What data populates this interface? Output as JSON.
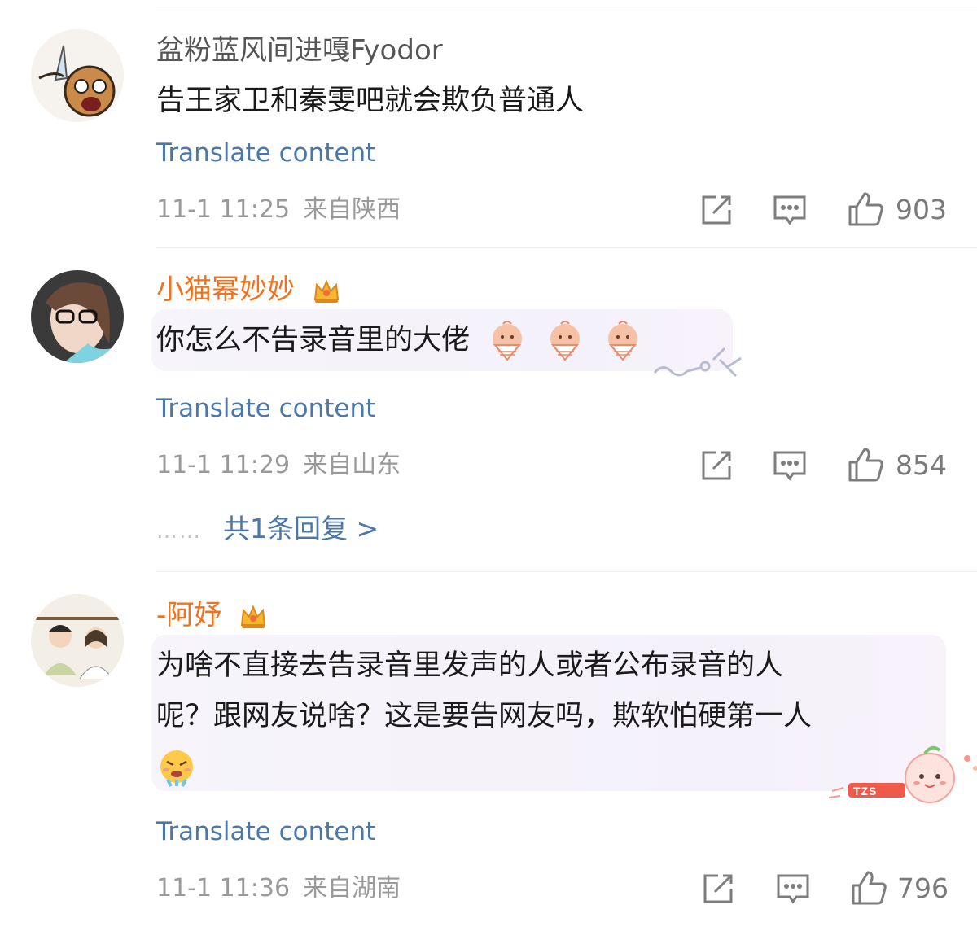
{
  "comments": [
    {
      "username": "盆粉蓝风间进嘎Fyodor",
      "text": "告王家卫和秦雯吧就会欺负普通人",
      "translate": "Translate content",
      "time": "11-1 11:25",
      "location": "来自陕西",
      "likes": "903"
    },
    {
      "username": "小猫幂妙妙",
      "text": "你怎么不告录音里的大佬",
      "translate": "Translate content",
      "time": "11-1 11:29",
      "location": "来自山东",
      "likes": "854",
      "replies": "共1条回复 >"
    },
    {
      "username": "-阿妤",
      "text_line1": "为啥不直接去告录音里发声的人或者公布录音的人",
      "text_line2": "呢？跟网友说啥？这是要告网友吗，欺软怕硬第一人",
      "translate": "Translate content",
      "time": "11-1 11:36",
      "location": "来自湖南",
      "likes": "796",
      "bubble_tag": "TZS"
    }
  ],
  "icons": {
    "share": "share-icon",
    "comment": "comment-icon",
    "like": "thumbs-up-icon",
    "crown": "crown-badge-icon",
    "emoji_fan": "fan-face-emoji",
    "emoji_angry": "steaming-face-emoji"
  },
  "colors": {
    "link": "#4b78a7",
    "vip_name": "#f2721c",
    "meta": "#9a9a9a"
  }
}
